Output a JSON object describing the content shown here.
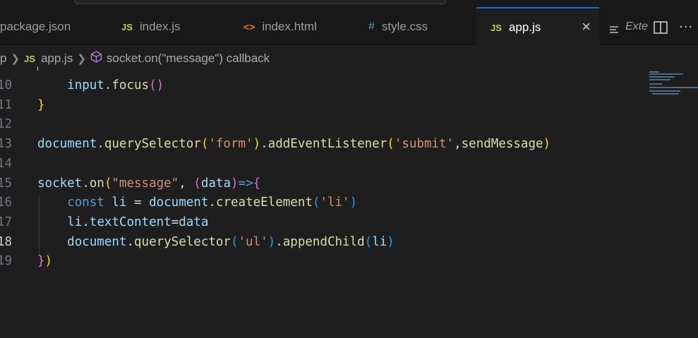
{
  "tabs": [
    {
      "label": "package.json",
      "icon": "json-file-icon",
      "active": false
    },
    {
      "label": "index.js",
      "icon_text": "JS",
      "active": false
    },
    {
      "label": "index.html",
      "icon_text": "<>",
      "active": false
    },
    {
      "label": "style.css",
      "icon_text": "#",
      "active": false
    },
    {
      "label": "app.js",
      "icon_text": "JS",
      "active": true,
      "close": "×"
    }
  ],
  "tab_actions": {
    "extension_label": "Exte",
    "split_icon": "split-editor-icon",
    "more_icon": "more-actions-icon",
    "more_text": "···"
  },
  "breadcrumb": {
    "root": "p",
    "file_icon_text": "JS",
    "file": "app.js",
    "symbol_icon": "method-cube-icon",
    "symbol": "socket.on(\"message\") callback"
  },
  "editor": {
    "current_line": 18,
    "lines": [
      {
        "num": "10",
        "tokens": [
          {
            "t": "    "
          },
          {
            "t": "input",
            "c": "var"
          },
          {
            "t": ".",
            "c": "punc"
          },
          {
            "t": "focus",
            "c": "fn"
          },
          {
            "t": "()",
            "c": "b2"
          }
        ]
      },
      {
        "num": "11",
        "tokens": [
          {
            "t": "}",
            "c": "b1"
          }
        ]
      },
      {
        "num": "12",
        "tokens": []
      },
      {
        "num": "13",
        "tokens": [
          {
            "t": "document",
            "c": "var"
          },
          {
            "t": ".",
            "c": "punc"
          },
          {
            "t": "querySelector",
            "c": "fn"
          },
          {
            "t": "(",
            "c": "b1"
          },
          {
            "t": "'form'",
            "c": "str"
          },
          {
            "t": ")",
            "c": "b1"
          },
          {
            "t": ".",
            "c": "punc"
          },
          {
            "t": "addEventListener",
            "c": "fn"
          },
          {
            "t": "(",
            "c": "b1"
          },
          {
            "t": "'submit'",
            "c": "str"
          },
          {
            "t": ",",
            "c": "punc"
          },
          {
            "t": "sendMessage",
            "c": "fn"
          },
          {
            "t": ")",
            "c": "b1"
          }
        ]
      },
      {
        "num": "14",
        "tokens": []
      },
      {
        "num": "15",
        "tokens": [
          {
            "t": "socket",
            "c": "var"
          },
          {
            "t": ".",
            "c": "punc"
          },
          {
            "t": "on",
            "c": "fn"
          },
          {
            "t": "(",
            "c": "b1"
          },
          {
            "t": "\"message\"",
            "c": "str"
          },
          {
            "t": ", ",
            "c": "punc"
          },
          {
            "t": "(",
            "c": "b2"
          },
          {
            "t": "data",
            "c": "var"
          },
          {
            "t": ")",
            "c": "b2"
          },
          {
            "t": "=>",
            "c": "kw"
          },
          {
            "t": "{",
            "c": "b2"
          }
        ]
      },
      {
        "num": "16",
        "tokens": [
          {
            "t": "    "
          },
          {
            "t": "const",
            "c": "kw"
          },
          {
            "t": " "
          },
          {
            "t": "li",
            "c": "var"
          },
          {
            "t": " = ",
            "c": "punc"
          },
          {
            "t": "document",
            "c": "var"
          },
          {
            "t": ".",
            "c": "punc"
          },
          {
            "t": "createElement",
            "c": "fn"
          },
          {
            "t": "(",
            "c": "b3"
          },
          {
            "t": "'li'",
            "c": "str"
          },
          {
            "t": ")",
            "c": "b3"
          }
        ]
      },
      {
        "num": "17",
        "tokens": [
          {
            "t": "    "
          },
          {
            "t": "li",
            "c": "var"
          },
          {
            "t": ".",
            "c": "punc"
          },
          {
            "t": "textContent",
            "c": "var"
          },
          {
            "t": "=",
            "c": "punc"
          },
          {
            "t": "data",
            "c": "var"
          }
        ]
      },
      {
        "num": "18",
        "tokens": [
          {
            "t": "    "
          },
          {
            "t": "document",
            "c": "var"
          },
          {
            "t": ".",
            "c": "punc"
          },
          {
            "t": "querySelector",
            "c": "fn"
          },
          {
            "t": "(",
            "c": "b3"
          },
          {
            "t": "'ul'",
            "c": "str"
          },
          {
            "t": ")",
            "c": "b3"
          },
          {
            "t": ".",
            "c": "punc"
          },
          {
            "t": "appendChild",
            "c": "fn"
          },
          {
            "t": "(",
            "c": "b3"
          },
          {
            "t": "li",
            "c": "var"
          },
          {
            "t": ")",
            "c": "b3"
          }
        ]
      },
      {
        "num": "19",
        "tokens": [
          {
            "t": "}",
            "c": "b2"
          },
          {
            "t": ")",
            "c": "b1"
          }
        ]
      }
    ]
  },
  "colors": {
    "background": "#1e1e1e",
    "tab_active_border": "#0078d4",
    "js_icon": "#cbcb41",
    "html_icon": "#e37933",
    "css_icon": "#519aba"
  }
}
